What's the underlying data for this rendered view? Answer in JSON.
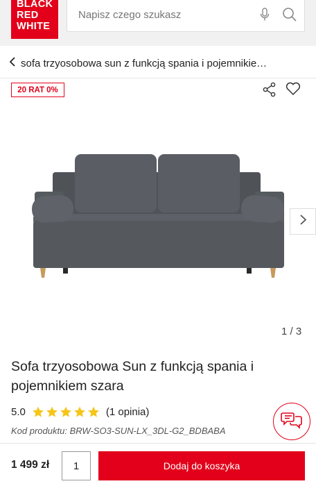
{
  "brand": {
    "logo_lines": [
      "BLACK",
      "RED",
      "WHITE"
    ],
    "color": "#e2001a"
  },
  "search": {
    "placeholder": "Napisz czego szukasz",
    "mic_icon": "microphone-icon",
    "search_icon": "search-icon"
  },
  "breadcrumb": {
    "text": "sofa trzyosobowa sun z funkcją spania i pojemnikie…"
  },
  "badge": {
    "text": "20 RAT 0%"
  },
  "gallery": {
    "current": "1",
    "total": "3",
    "counter": "1 / 3"
  },
  "product": {
    "title": "Sofa trzyosobowa Sun z funkcją spania i pojemnikiem szara",
    "rating_value": "5.0",
    "rating_stars": 5,
    "rating_count": "(1 opinia)",
    "code_label": "Kod produktu:",
    "code_value": "BRW-SO3-SUN-LX_3DL-G2_BDBABA"
  },
  "cart": {
    "price": "1 499 zł",
    "quantity": "1",
    "add_label": "Dodaj do koszyka"
  },
  "colors": {
    "accent": "#e2001a",
    "star": "#f5c518",
    "sofa": "#55595e"
  }
}
